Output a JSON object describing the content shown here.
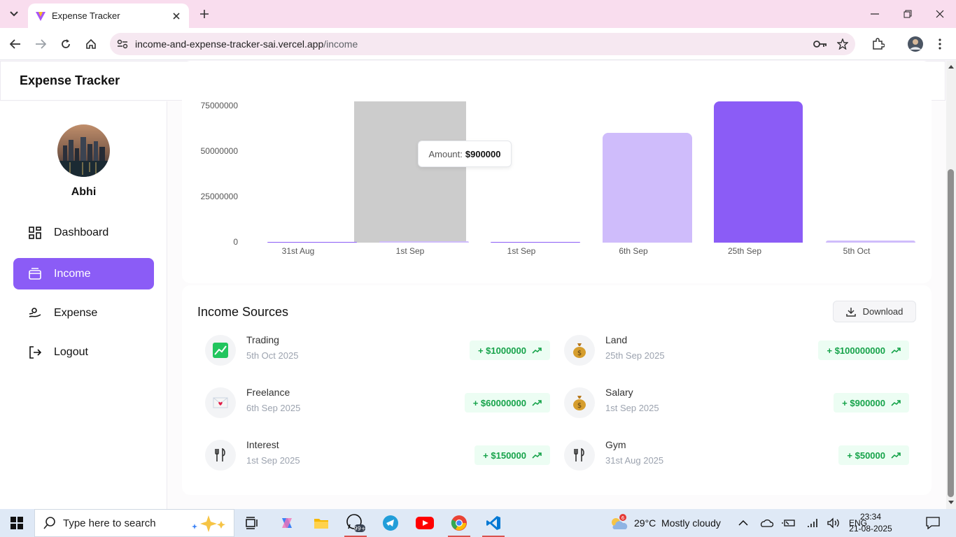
{
  "browser": {
    "tab_title": "Expense Tracker",
    "url_host": "income-and-expense-tracker-sai.vercel.app",
    "url_path": "/income"
  },
  "app": {
    "title": "Expense Tracker",
    "user_name": "Abhi",
    "menu": [
      {
        "label": "Dashboard",
        "icon": "dashboard-icon",
        "active": false
      },
      {
        "label": "Income",
        "icon": "wallet-icon",
        "active": true
      },
      {
        "label": "Expense",
        "icon": "expense-icon",
        "active": false
      },
      {
        "label": "Logout",
        "icon": "logout-icon",
        "active": false
      }
    ],
    "accent_color": "#8b5cf6"
  },
  "chart_data": {
    "type": "bar",
    "categories": [
      "31st Aug",
      "1st Sep",
      "1st Sep",
      "6th Sep",
      "25th Sep",
      "5th Oct"
    ],
    "values": [
      50000,
      900000,
      150000,
      60000000,
      100000000,
      1000000
    ],
    "y_ticks": [
      "0",
      "25000000",
      "50000000",
      "75000000"
    ],
    "ylim": [
      0,
      75000000
    ],
    "grid": false,
    "highlighted_index": 1,
    "bar_colors": [
      "#cfbcfb",
      "#8b5cf6"
    ],
    "tooltip": {
      "label": "Amount:",
      "value": "$900000"
    }
  },
  "income_sources": {
    "title": "Income Sources",
    "download_label": "Download",
    "items": [
      {
        "name": "Trading",
        "date": "5th Oct 2025",
        "amount": "+ $1000000",
        "icon": "chart-emoji-icon"
      },
      {
        "name": "Land",
        "date": "25th Sep 2025",
        "amount": "+ $100000000",
        "icon": "money-bag-icon"
      },
      {
        "name": "Freelance",
        "date": "6th Sep 2025",
        "amount": "+ $60000000",
        "icon": "love-letter-icon"
      },
      {
        "name": "Salary",
        "date": "1st Sep 2025",
        "amount": "+ $900000",
        "icon": "money-bag-icon"
      },
      {
        "name": "Interest",
        "date": "1st Sep 2025",
        "amount": "+ $150000",
        "icon": "utensils-icon"
      },
      {
        "name": "Gym",
        "date": "31st Aug 2025",
        "amount": "+ $50000",
        "icon": "utensils-icon"
      }
    ]
  },
  "taskbar": {
    "search_placeholder": "Type here to search",
    "whatsapp_badge": "99+",
    "weather_badge": "6",
    "weather": "29°C  Mostly cloudy",
    "language": "ENG",
    "time": "23:34",
    "date": "21-08-2025"
  }
}
